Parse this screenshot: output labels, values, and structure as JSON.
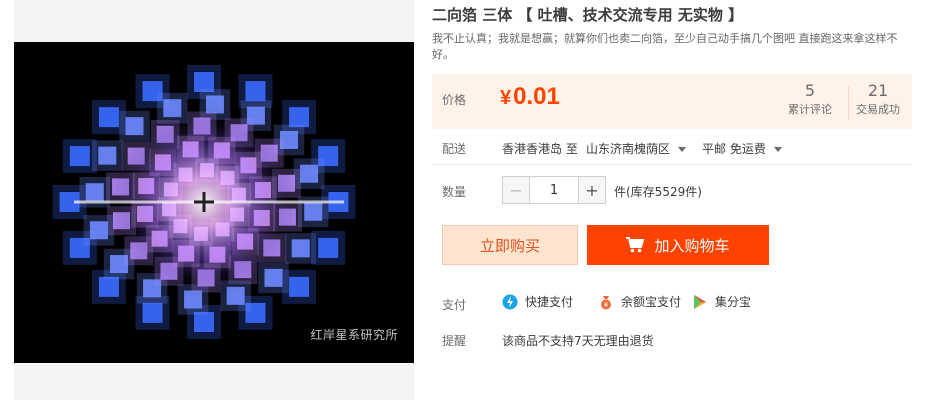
{
  "product": {
    "title": "二向箔 三体 【 吐槽、技术交流专用 无实物 】",
    "subtitle": "我不止认真；我就是想赢；就算你们也卖二向箔，至少自己动手搞几个图吧 直接跑这来拿这样不好。",
    "image_watermark": "红岸星系研究所"
  },
  "price": {
    "label": "价格",
    "currency": "¥",
    "value": "0.01",
    "reviews_count": "5",
    "reviews_label": "累计评论",
    "transactions_count": "21",
    "transactions_label": "交易成功"
  },
  "shipping": {
    "label": "配送",
    "from": "香港香港岛",
    "to_word": "至",
    "destination": "山东济南槐荫区",
    "fee": "平邮 免运费"
  },
  "quantity": {
    "label": "数量",
    "value": "1",
    "minus": "−",
    "plus": "+",
    "stock": "件(库存5529件)"
  },
  "actions": {
    "buy_now": "立即购买",
    "add_to_cart": "加入购物车"
  },
  "payment": {
    "label": "支付",
    "methods": [
      {
        "name": "快捷支付",
        "icon": "quick-pay-icon"
      },
      {
        "name": "余额宝支付",
        "icon": "yuebao-icon"
      },
      {
        "name": "集分宝",
        "icon": "jifenbao-icon"
      }
    ]
  },
  "reminder": {
    "label": "提醒",
    "text": "该商品不支持7天无理由退货"
  },
  "colors": {
    "accent": "#ff4200",
    "price": "#ff4400",
    "price_bg": "#fff2e8"
  }
}
